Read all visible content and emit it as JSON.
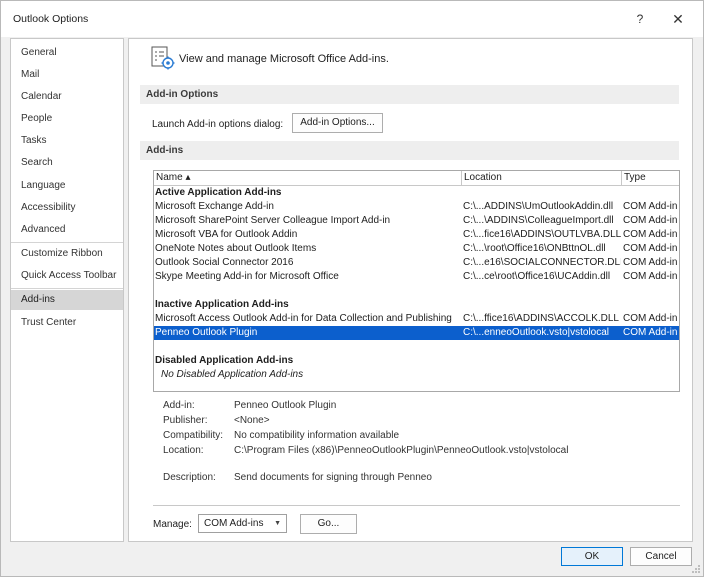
{
  "window": {
    "title": "Outlook Options",
    "help_label": "?",
    "close_label": "✕"
  },
  "sidebar": {
    "items": [
      {
        "label": "General"
      },
      {
        "label": "Mail"
      },
      {
        "label": "Calendar"
      },
      {
        "label": "People"
      },
      {
        "label": "Tasks"
      },
      {
        "label": "Search"
      },
      {
        "label": "Language"
      },
      {
        "label": "Accessibility"
      },
      {
        "label": "Advanced"
      },
      {
        "label": "Customize Ribbon"
      },
      {
        "label": "Quick Access Toolbar"
      },
      {
        "label": "Add-ins",
        "selected": true
      },
      {
        "label": "Trust Center"
      }
    ]
  },
  "main": {
    "header_text": "View and manage Microsoft Office Add-ins.",
    "addin_options_section": "Add-in Options",
    "launch_label": "Launch Add-in options dialog:",
    "addin_options_button": "Add-in Options...",
    "addins_section": "Add-ins",
    "table": {
      "columns": {
        "name": "Name ▴",
        "location": "Location",
        "type": "Type"
      },
      "active_group": "Active Application Add-ins",
      "active_rows": [
        {
          "name": "Microsoft Exchange Add-in",
          "location": "C:\\...ADDINS\\UmOutlookAddin.dll",
          "type": "COM Add-in"
        },
        {
          "name": "Microsoft SharePoint Server Colleague Import Add-in",
          "location": "C:\\...\\ADDINS\\ColleagueImport.dll",
          "type": "COM Add-in"
        },
        {
          "name": "Microsoft VBA for Outlook Addin",
          "location": "C:\\...fice16\\ADDINS\\OUTLVBA.DLL",
          "type": "COM Add-in"
        },
        {
          "name": "OneNote Notes about Outlook Items",
          "location": "C:\\...\\root\\Office16\\ONBttnOL.dll",
          "type": "COM Add-in"
        },
        {
          "name": "Outlook Social Connector 2016",
          "location": "C:\\...e16\\SOCIALCONNECTOR.DLL",
          "type": "COM Add-in"
        },
        {
          "name": "Skype Meeting Add-in for Microsoft Office",
          "location": "C:\\...ce\\root\\Office16\\UCAddin.dll",
          "type": "COM Add-in"
        }
      ],
      "inactive_group": "Inactive Application Add-ins",
      "inactive_rows": [
        {
          "name": "Microsoft Access Outlook Add-in for Data Collection and Publishing",
          "location": "C:\\...ffice16\\ADDINS\\ACCOLK.DLL",
          "type": "COM Add-in"
        },
        {
          "name": "Penneo Outlook Plugin",
          "location": "C:\\...enneoOutlook.vsto|vstolocal",
          "type": "COM Add-in",
          "selected": true
        }
      ],
      "disabled_group": "Disabled Application Add-ins",
      "disabled_empty": "No Disabled Application Add-ins"
    },
    "details": {
      "addin_label": "Add-in:",
      "addin_value": "Penneo Outlook Plugin",
      "publisher_label": "Publisher:",
      "publisher_value": "<None>",
      "compat_label": "Compatibility:",
      "compat_value": "No compatibility information available",
      "location_label": "Location:",
      "location_value": "C:\\Program Files (x86)\\PenneoOutlookPlugin\\PenneoOutlook.vsto|vstolocal",
      "description_label": "Description:",
      "description_value": "Send documents for signing through Penneo"
    },
    "manage_label": "Manage:",
    "manage_selected": "COM Add-ins",
    "go_button": "Go..."
  },
  "footer": {
    "ok_button": "OK",
    "cancel_button": "Cancel"
  },
  "colors": {
    "selection": "#0c5fcd",
    "sidebar_selected": "#d6d6d6",
    "ok_border": "#0078d7"
  }
}
